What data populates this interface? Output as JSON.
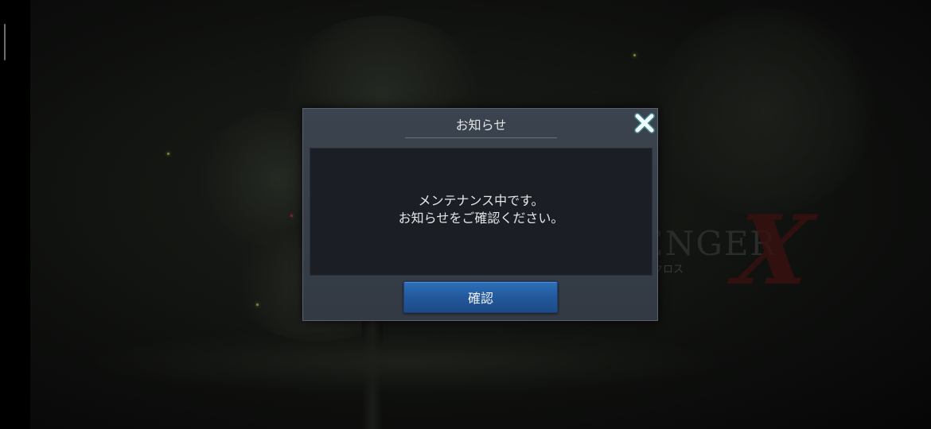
{
  "background": {
    "logo_text": "DARK AVENGER",
    "logo_x": "X",
    "logo_sub": "クロス"
  },
  "dialog": {
    "title": "お知らせ",
    "message_line1": "メンテナンス中です。",
    "message_line2": "お知らせをご確認ください。",
    "confirm_label": "確認",
    "close_icon": "close-x-icon"
  },
  "colors": {
    "dialog_bg": "#39414c",
    "panel_bg": "#1b1e24",
    "button_blue": "#2563a8",
    "close_icon_cyan": "#9fe8ec"
  }
}
